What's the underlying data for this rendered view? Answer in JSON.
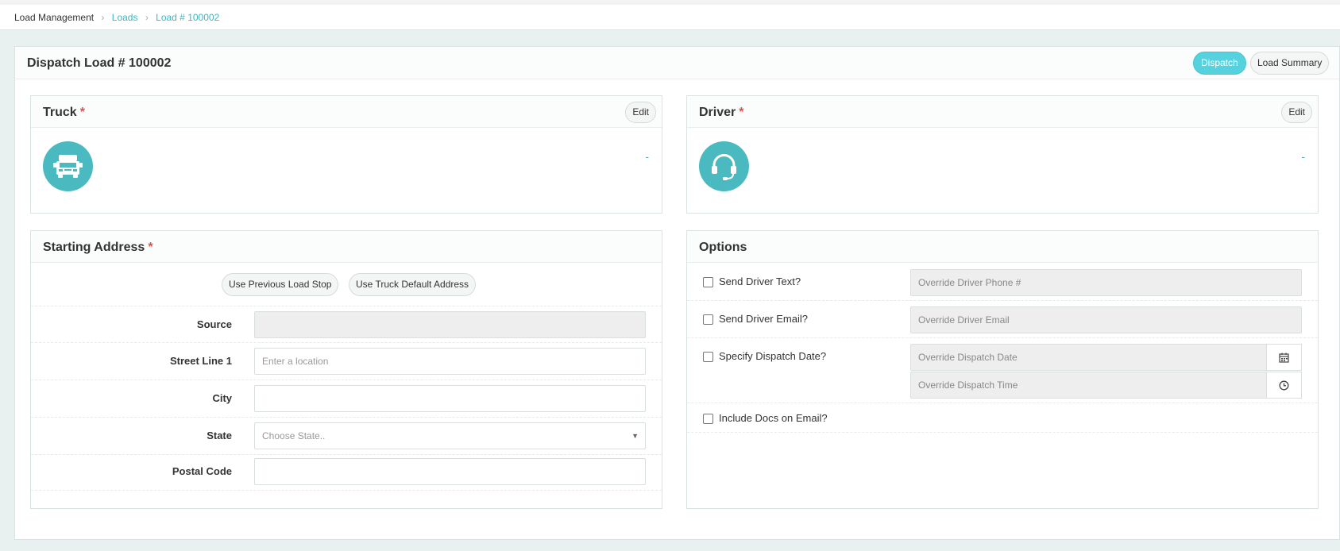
{
  "breadcrumb": {
    "root": "Load Management",
    "items": [
      "Loads",
      "Load # 100002"
    ]
  },
  "page": {
    "title": "Dispatch Load # 100002",
    "dispatch_button": "Dispatch",
    "load_summary_button": "Load Summary"
  },
  "truck": {
    "title": "Truck",
    "required_mark": "*",
    "edit_label": "Edit",
    "value": "-",
    "icon": "truck-icon"
  },
  "driver": {
    "title": "Driver",
    "required_mark": "*",
    "edit_label": "Edit",
    "value": "-",
    "icon": "headset-icon"
  },
  "starting_address": {
    "title": "Starting Address",
    "required_mark": "*",
    "use_previous_label": "Use Previous Load Stop",
    "use_truck_default_label": "Use Truck Default Address",
    "fields": {
      "source": {
        "label": "Source",
        "value": "",
        "placeholder": ""
      },
      "street_line_1": {
        "label": "Street Line 1",
        "value": "",
        "placeholder": "Enter a location"
      },
      "city": {
        "label": "City",
        "value": "",
        "placeholder": ""
      },
      "state": {
        "label": "State",
        "value": "",
        "placeholder": "Choose State.."
      },
      "postal_code": {
        "label": "Postal Code",
        "value": "",
        "placeholder": ""
      }
    }
  },
  "options": {
    "title": "Options",
    "send_driver_text": {
      "label": "Send Driver Text?",
      "checked": false,
      "input_placeholder": "Override Driver Phone #"
    },
    "send_driver_email": {
      "label": "Send Driver Email?",
      "checked": false,
      "input_placeholder": "Override Driver Email"
    },
    "specify_dispatch_date": {
      "label": "Specify Dispatch Date?",
      "checked": false,
      "date_placeholder": "Override Dispatch Date",
      "time_placeholder": "Override Dispatch Time"
    },
    "include_docs_on_email": {
      "label": "Include Docs on Email?",
      "checked": false
    }
  },
  "colors": {
    "accent": "#4bb9c0",
    "dispatch_button": "#55d2de",
    "link": "#43b3bd",
    "required": "#e84b4b"
  }
}
